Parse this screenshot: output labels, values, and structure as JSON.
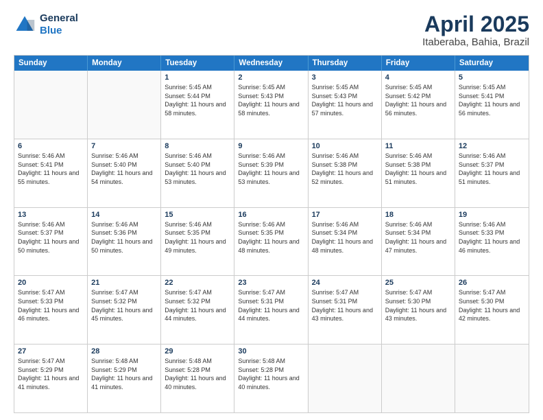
{
  "header": {
    "logo_line1": "General",
    "logo_line2": "Blue",
    "main_title": "April 2025",
    "subtitle": "Itaberaba, Bahia, Brazil"
  },
  "calendar": {
    "days_of_week": [
      "Sunday",
      "Monday",
      "Tuesday",
      "Wednesday",
      "Thursday",
      "Friday",
      "Saturday"
    ],
    "weeks": [
      [
        {
          "day": "",
          "info": ""
        },
        {
          "day": "",
          "info": ""
        },
        {
          "day": "1",
          "info": "Sunrise: 5:45 AM\nSunset: 5:44 PM\nDaylight: 11 hours and 58 minutes."
        },
        {
          "day": "2",
          "info": "Sunrise: 5:45 AM\nSunset: 5:43 PM\nDaylight: 11 hours and 58 minutes."
        },
        {
          "day": "3",
          "info": "Sunrise: 5:45 AM\nSunset: 5:43 PM\nDaylight: 11 hours and 57 minutes."
        },
        {
          "day": "4",
          "info": "Sunrise: 5:45 AM\nSunset: 5:42 PM\nDaylight: 11 hours and 56 minutes."
        },
        {
          "day": "5",
          "info": "Sunrise: 5:45 AM\nSunset: 5:41 PM\nDaylight: 11 hours and 56 minutes."
        }
      ],
      [
        {
          "day": "6",
          "info": "Sunrise: 5:46 AM\nSunset: 5:41 PM\nDaylight: 11 hours and 55 minutes."
        },
        {
          "day": "7",
          "info": "Sunrise: 5:46 AM\nSunset: 5:40 PM\nDaylight: 11 hours and 54 minutes."
        },
        {
          "day": "8",
          "info": "Sunrise: 5:46 AM\nSunset: 5:40 PM\nDaylight: 11 hours and 53 minutes."
        },
        {
          "day": "9",
          "info": "Sunrise: 5:46 AM\nSunset: 5:39 PM\nDaylight: 11 hours and 53 minutes."
        },
        {
          "day": "10",
          "info": "Sunrise: 5:46 AM\nSunset: 5:38 PM\nDaylight: 11 hours and 52 minutes."
        },
        {
          "day": "11",
          "info": "Sunrise: 5:46 AM\nSunset: 5:38 PM\nDaylight: 11 hours and 51 minutes."
        },
        {
          "day": "12",
          "info": "Sunrise: 5:46 AM\nSunset: 5:37 PM\nDaylight: 11 hours and 51 minutes."
        }
      ],
      [
        {
          "day": "13",
          "info": "Sunrise: 5:46 AM\nSunset: 5:37 PM\nDaylight: 11 hours and 50 minutes."
        },
        {
          "day": "14",
          "info": "Sunrise: 5:46 AM\nSunset: 5:36 PM\nDaylight: 11 hours and 50 minutes."
        },
        {
          "day": "15",
          "info": "Sunrise: 5:46 AM\nSunset: 5:35 PM\nDaylight: 11 hours and 49 minutes."
        },
        {
          "day": "16",
          "info": "Sunrise: 5:46 AM\nSunset: 5:35 PM\nDaylight: 11 hours and 48 minutes."
        },
        {
          "day": "17",
          "info": "Sunrise: 5:46 AM\nSunset: 5:34 PM\nDaylight: 11 hours and 48 minutes."
        },
        {
          "day": "18",
          "info": "Sunrise: 5:46 AM\nSunset: 5:34 PM\nDaylight: 11 hours and 47 minutes."
        },
        {
          "day": "19",
          "info": "Sunrise: 5:46 AM\nSunset: 5:33 PM\nDaylight: 11 hours and 46 minutes."
        }
      ],
      [
        {
          "day": "20",
          "info": "Sunrise: 5:47 AM\nSunset: 5:33 PM\nDaylight: 11 hours and 46 minutes."
        },
        {
          "day": "21",
          "info": "Sunrise: 5:47 AM\nSunset: 5:32 PM\nDaylight: 11 hours and 45 minutes."
        },
        {
          "day": "22",
          "info": "Sunrise: 5:47 AM\nSunset: 5:32 PM\nDaylight: 11 hours and 44 minutes."
        },
        {
          "day": "23",
          "info": "Sunrise: 5:47 AM\nSunset: 5:31 PM\nDaylight: 11 hours and 44 minutes."
        },
        {
          "day": "24",
          "info": "Sunrise: 5:47 AM\nSunset: 5:31 PM\nDaylight: 11 hours and 43 minutes."
        },
        {
          "day": "25",
          "info": "Sunrise: 5:47 AM\nSunset: 5:30 PM\nDaylight: 11 hours and 43 minutes."
        },
        {
          "day": "26",
          "info": "Sunrise: 5:47 AM\nSunset: 5:30 PM\nDaylight: 11 hours and 42 minutes."
        }
      ],
      [
        {
          "day": "27",
          "info": "Sunrise: 5:47 AM\nSunset: 5:29 PM\nDaylight: 11 hours and 41 minutes."
        },
        {
          "day": "28",
          "info": "Sunrise: 5:48 AM\nSunset: 5:29 PM\nDaylight: 11 hours and 41 minutes."
        },
        {
          "day": "29",
          "info": "Sunrise: 5:48 AM\nSunset: 5:28 PM\nDaylight: 11 hours and 40 minutes."
        },
        {
          "day": "30",
          "info": "Sunrise: 5:48 AM\nSunset: 5:28 PM\nDaylight: 11 hours and 40 minutes."
        },
        {
          "day": "",
          "info": ""
        },
        {
          "day": "",
          "info": ""
        },
        {
          "day": "",
          "info": ""
        }
      ]
    ]
  }
}
